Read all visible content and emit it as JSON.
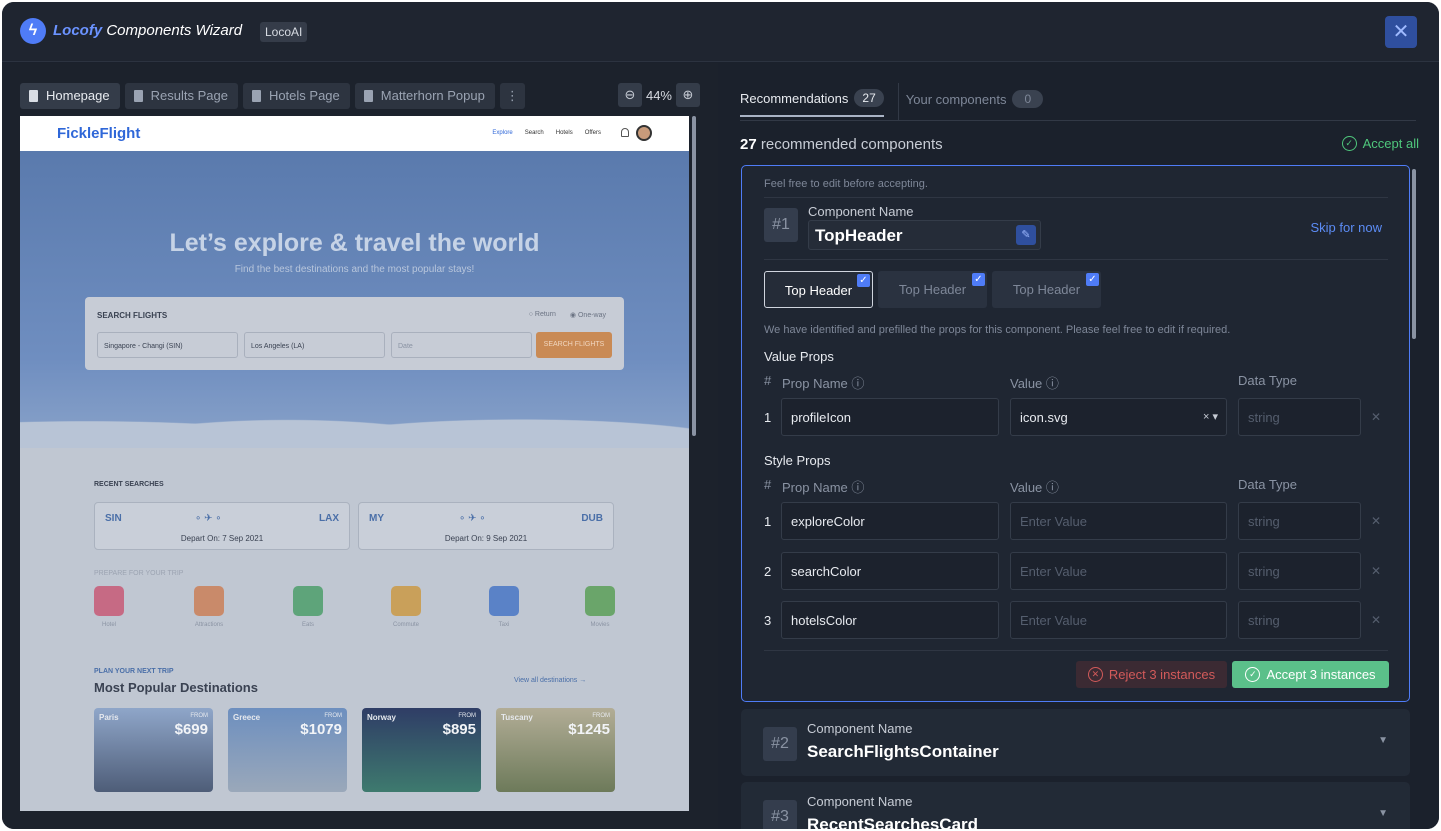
{
  "titlebar": {
    "brand_name": "Locofy",
    "brand_suffix": "Components Wizard",
    "badge": "LocoAI",
    "close_icon": "close-icon"
  },
  "left": {
    "tabs": [
      {
        "label": "Homepage",
        "active": true
      },
      {
        "label": "Results Page",
        "active": false
      },
      {
        "label": "Hotels Page",
        "active": false
      },
      {
        "label": "Matterhorn Popup",
        "active": false
      }
    ],
    "more": "⋮",
    "zoom": "44%"
  },
  "preview": {
    "logo": "FickleFlight",
    "nav": [
      "Explore",
      "Search",
      "Hotels",
      "Offers"
    ],
    "hero_title": "Let’s explore & travel the world",
    "hero_sub": "Find the best destinations and the most popular stays!",
    "search_title": "SEARCH FLIGHTS",
    "radio_return": "Return",
    "radio_oneway": "One-way",
    "departure": "Singapore - Changi (SIN)",
    "arrival": "Los Angeles (LA)",
    "date": "Date",
    "search_btn": "SEARCH FLIGHTS",
    "recent": "RECENT SEARCHES",
    "cards": [
      {
        "from": "SIN",
        "to": "LAX",
        "depart": "Depart On: 7 Sep 2021"
      },
      {
        "from": "MY",
        "to": "DUB",
        "depart": "Depart On: 9 Sep 2021"
      }
    ],
    "prepare": "PREPARE FOR YOUR TRIP",
    "icons": [
      "Hotel",
      "Attractions",
      "Eats",
      "Commute",
      "Taxi",
      "Movies"
    ],
    "plan": "PLAN YOUR NEXT TRIP",
    "popular": "Most Popular Destinations",
    "view_all": "View all destinations →",
    "dests": [
      {
        "name": "Paris",
        "from": "FROM",
        "price": "$699"
      },
      {
        "name": "Greece",
        "from": "FROM",
        "price": "$1079"
      },
      {
        "name": "Norway",
        "from": "FROM",
        "price": "$895"
      },
      {
        "name": "Tuscany",
        "from": "FROM",
        "price": "$1245"
      }
    ]
  },
  "right": {
    "tab_recommendations": "Recommendations",
    "tab_recommendations_count": "27",
    "tab_yours": "Your components",
    "tab_yours_count": "0",
    "rec_count": "27",
    "rec_text": "recommended components",
    "accept_all": "Accept all",
    "card1": {
      "hint": "Feel free to edit before accepting.",
      "num": "#1",
      "label": "Component Name",
      "name": "TopHeader",
      "skip": "Skip for now",
      "instances": [
        "Top Header",
        "Top Header",
        "Top Header"
      ],
      "info": "We have identified and prefilled the props for this component. Please feel free to edit if required.",
      "value_props": "Value Props",
      "style_props": "Style Props",
      "col_hash": "#",
      "col_prop": "Prop Name",
      "col_value": "Value",
      "col_type": "Data Type",
      "value_rows": [
        {
          "n": "1",
          "prop": "profileIcon",
          "value": "icon.svg",
          "type": "string"
        }
      ],
      "style_rows": [
        {
          "n": "1",
          "prop": "exploreColor",
          "value": "Enter Value",
          "type": "string"
        },
        {
          "n": "2",
          "prop": "searchColor",
          "value": "Enter Value",
          "type": "string"
        },
        {
          "n": "3",
          "prop": "hotelsColor",
          "value": "Enter Value",
          "type": "string"
        }
      ],
      "reject": "Reject 3 instances",
      "accept": "Accept 3 instances"
    },
    "card2": {
      "num": "#2",
      "label": "Component Name",
      "name": "SearchFlightsContainer"
    },
    "card3": {
      "num": "#3",
      "label": "Component Name",
      "name": "RecentSearchesCard"
    }
  },
  "colors": {
    "accent": "#4f7cf7",
    "accept": "#5bc08a",
    "reject": "#d25a5a",
    "background": "#1b212c"
  }
}
